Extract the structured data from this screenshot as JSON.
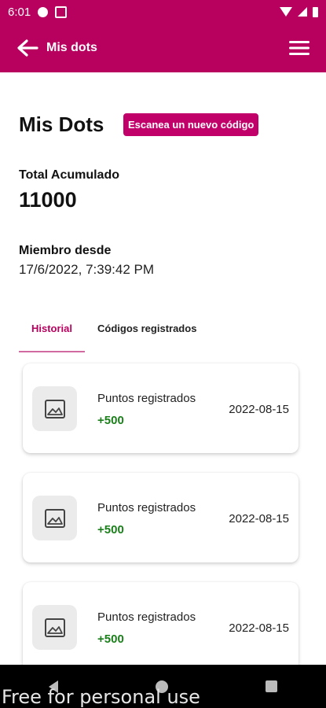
{
  "status_bar": {
    "time": "6:01"
  },
  "app_bar": {
    "title": "Mis dots"
  },
  "header": {
    "title": "Mis Dots",
    "scan_button": "Escanea un nuevo código",
    "total_label": "Total Acumulado",
    "total_value": "11000",
    "member_label": "Miembro desde",
    "member_value": "17/6/2022, 7:39:42 PM"
  },
  "tabs": [
    {
      "label": "Historial",
      "active": true
    },
    {
      "label": "Códigos registrados",
      "active": false
    }
  ],
  "history": [
    {
      "title": "Puntos registrados",
      "points": "+500",
      "date": "2022-08-15"
    },
    {
      "title": "Puntos registrados",
      "points": "+500",
      "date": "2022-08-15"
    },
    {
      "title": "Puntos registrados",
      "points": "+500",
      "date": "2022-08-15"
    }
  ],
  "watermark": "Free for personal use",
  "colors": {
    "brand": "#b8005e",
    "points_green": "#1a7f1a"
  }
}
